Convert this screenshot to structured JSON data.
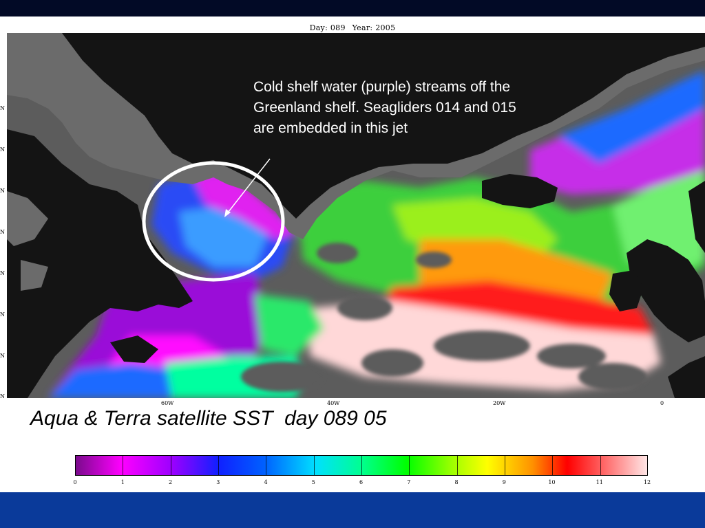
{
  "header": {
    "day_label": "Day: 089",
    "year_label": "Year: 2005"
  },
  "annotation": "Cold shelf water (purple) streams off the Greenland shelf. Seagliders 014 and 015 are embedded in this jet",
  "caption": "Aqua & Terra satellite SST  day 089 05",
  "axes": {
    "lat_labels": [
      "N",
      "N",
      "N",
      "N",
      "N",
      "N",
      "N",
      "N"
    ],
    "lon_labels": [
      "60W",
      "40W",
      "20W",
      "0"
    ]
  },
  "colorbar": {
    "ticks": [
      "0",
      "1",
      "2",
      "3",
      "4",
      "5",
      "6",
      "7",
      "8",
      "9",
      "10",
      "11",
      "12"
    ]
  },
  "colors": {
    "land": "#141414",
    "no_data": "#5c5c5c",
    "ice_land": "#6b6b6b",
    "highlight_circle": "#ffffff",
    "slide_top": "#020a26",
    "slide_bottom": "#0a3a9a"
  }
}
